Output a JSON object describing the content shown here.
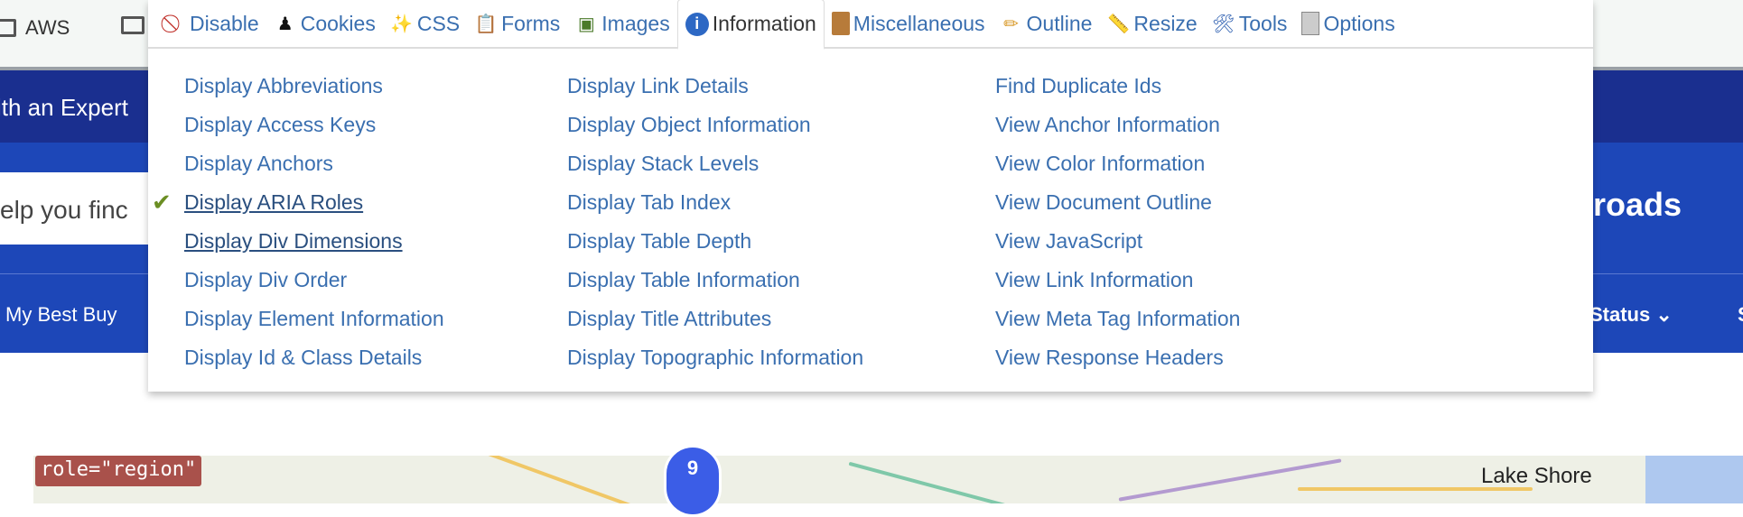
{
  "bookmarks": [
    "AWS",
    ""
  ],
  "site": {
    "banner_text": "ith an Expert",
    "search_text": "elp you finc",
    "heading_fragment": "roads",
    "nav_left": "My Best Buy",
    "nav_status": "Status",
    "nav_right": "S"
  },
  "toolbar": {
    "tabs": [
      {
        "label": "Disable",
        "icon": "disable-icon"
      },
      {
        "label": "Cookies",
        "icon": "cookies-icon"
      },
      {
        "label": "CSS",
        "icon": "css-wand-icon"
      },
      {
        "label": "Forms",
        "icon": "clipboard-icon"
      },
      {
        "label": "Images",
        "icon": "image-icon"
      },
      {
        "label": "Information",
        "icon": "info-icon",
        "active": true
      },
      {
        "label": "Miscellaneous",
        "icon": "crate-icon"
      },
      {
        "label": "Outline",
        "icon": "pencil-icon"
      },
      {
        "label": "Resize",
        "icon": "ruler-icon"
      },
      {
        "label": "Tools",
        "icon": "tools-icon"
      },
      {
        "label": "Options",
        "icon": "switch-icon"
      }
    ]
  },
  "menu": {
    "columns": [
      [
        "Display Abbreviations",
        "Display Access Keys",
        "Display Anchors",
        "Display ARIA Roles",
        "Display Div Dimensions",
        "Display Div Order",
        "Display Element Information",
        "Display Id & Class Details"
      ],
      [
        "Display Link Details",
        "Display Object Information",
        "Display Stack Levels",
        "Display Tab Index",
        "Display Table Depth",
        "Display Table Information",
        "Display Title Attributes",
        "Display Topographic Information"
      ],
      [
        "Find Duplicate Ids",
        "View Anchor Information",
        "View Color Information",
        "View Document Outline",
        "View JavaScript",
        "View Link Information",
        "View Meta Tag Information",
        "View Response Headers"
      ]
    ],
    "checked": "Display ARIA Roles"
  },
  "map": {
    "role_label": "role=\"region\"",
    "marker_count": "9",
    "place_label": "Lake Shore"
  }
}
